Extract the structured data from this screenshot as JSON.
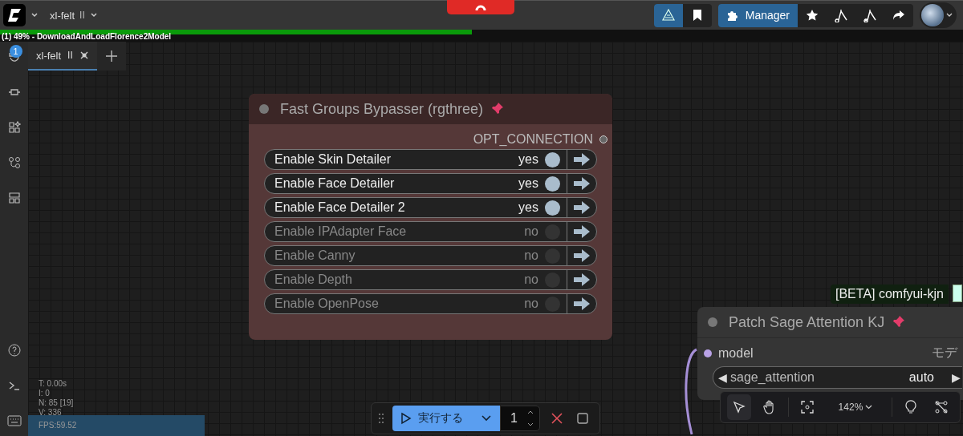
{
  "app_bar": {
    "workflow_title": "xl-felt",
    "workflow_marker": "II",
    "manager_label": "Manager"
  },
  "progress": {
    "text": "(1) 49% - DownloadAndLoadFlorence2Model",
    "level": 0.49
  },
  "queue_badge": "1",
  "tabs": [
    {
      "label": "xl-felt",
      "marker": "II",
      "selected": true
    }
  ],
  "groups_node": {
    "title": "Fast Groups Bypasser (rgthree)",
    "output": "OPT_CONNECTION",
    "toggles": [
      {
        "label": "Enable Skin Detailer",
        "state": "yes",
        "on": true
      },
      {
        "label": "Enable Face Detailer",
        "state": "yes",
        "on": true
      },
      {
        "label": "Enable Face Detailer 2",
        "state": "yes",
        "on": true
      },
      {
        "label": "Enable IPAdapter Face",
        "state": "no",
        "on": false
      },
      {
        "label": "Enable Canny",
        "state": "no",
        "on": false
      },
      {
        "label": "Enable Depth",
        "state": "no",
        "on": false
      },
      {
        "label": "Enable OpenPose",
        "state": "no",
        "on": false
      }
    ]
  },
  "beta_tag": "[BETA] comfyui-kjn",
  "sage_node": {
    "title": "Patch Sage Attention KJ",
    "input": "model",
    "output": "モデ",
    "widget": {
      "prev_arrow": "◀",
      "name": "sage_attention",
      "value": "auto",
      "next_arrow": "▶"
    }
  },
  "stats": [
    "T: 0.00s",
    "I: 0",
    "N: 85 [19]",
    "V: 336",
    "FPS:59.52"
  ],
  "run_bar": {
    "run_label": "実行する",
    "count": "1"
  },
  "canvas_toolbar": {
    "zoom": "142%"
  }
}
